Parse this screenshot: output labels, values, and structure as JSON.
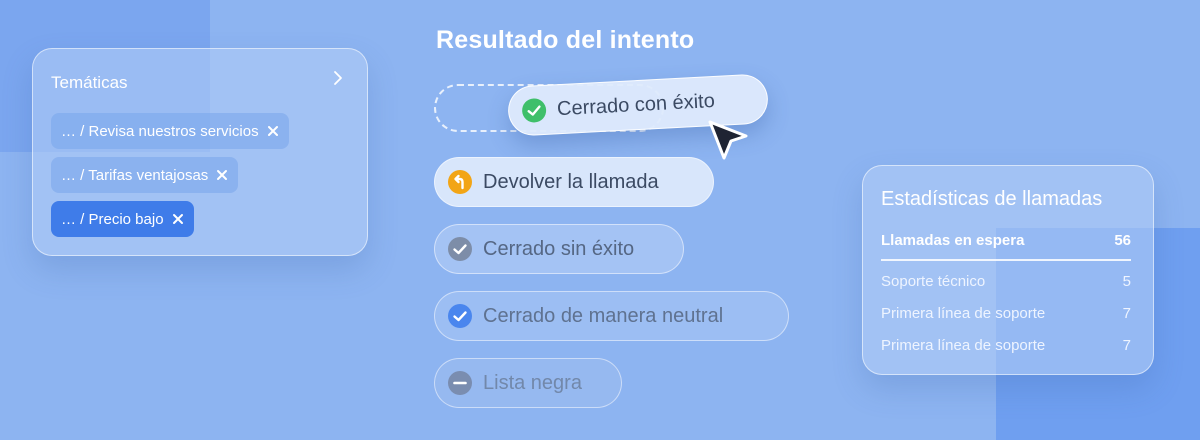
{
  "topics": {
    "title": "Temáticas",
    "chips": [
      {
        "label": "… / Revisa nuestros servicios",
        "active": false
      },
      {
        "label": "… / Tarifas ventajosas",
        "active": false
      },
      {
        "label": "… / Precio bajo",
        "active": true
      }
    ]
  },
  "result": {
    "title": "Resultado del intento",
    "dragging": {
      "label": "Cerrado con éxito",
      "icon": "check-circle-green-icon"
    },
    "options": [
      {
        "label": "Devolver la llamada",
        "icon": "callback-orange-icon"
      },
      {
        "label": "Cerrado sin éxito",
        "icon": "check-circle-gray-icon"
      },
      {
        "label": "Cerrado de manera neutral",
        "icon": "check-circle-blue-icon"
      },
      {
        "label": "Lista negra",
        "icon": "minus-circle-icon"
      }
    ]
  },
  "stats": {
    "title": "Estadísticas de llamadas",
    "header": {
      "label": "Llamadas en espera",
      "value": "56"
    },
    "rows": [
      {
        "label": "Soporte técnico",
        "value": "5"
      },
      {
        "label": "Primera línea de soporte",
        "value": "7"
      },
      {
        "label": "Primera línea de soporte",
        "value": "7"
      }
    ]
  },
  "colors": {
    "background": "#8db4f1",
    "chip_active": "#3f7ce9",
    "success": "#3fbf6a",
    "callback": "#f2a516",
    "neutral": "#4a86ee"
  }
}
